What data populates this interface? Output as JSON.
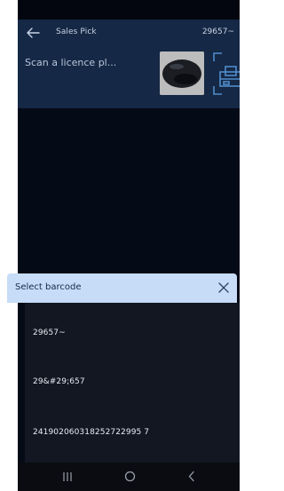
{
  "header": {
    "title": "Sales Pick",
    "code": "29657~"
  },
  "scan": {
    "placeholder": "Scan a licence pl..."
  },
  "barcode_sheet": {
    "title": "Select barcode",
    "items": [
      {
        "value": "29657~"
      },
      {
        "value": "29&#29;657"
      },
      {
        "value": "241902060318252722995 7"
      }
    ]
  },
  "colors": {
    "header_bg": "#152845",
    "sheet_header_bg": "#c7dcf7",
    "list_bg": "#121722",
    "screen_bg": "#050a17"
  },
  "icons": {
    "back": "arrow-left-icon",
    "scanner": "scanner-device-image",
    "scan_target": "scan-target-icon",
    "close": "close-icon",
    "nav_recents": "recents-icon",
    "nav_home": "home-icon",
    "nav_back": "chevron-left-icon"
  }
}
